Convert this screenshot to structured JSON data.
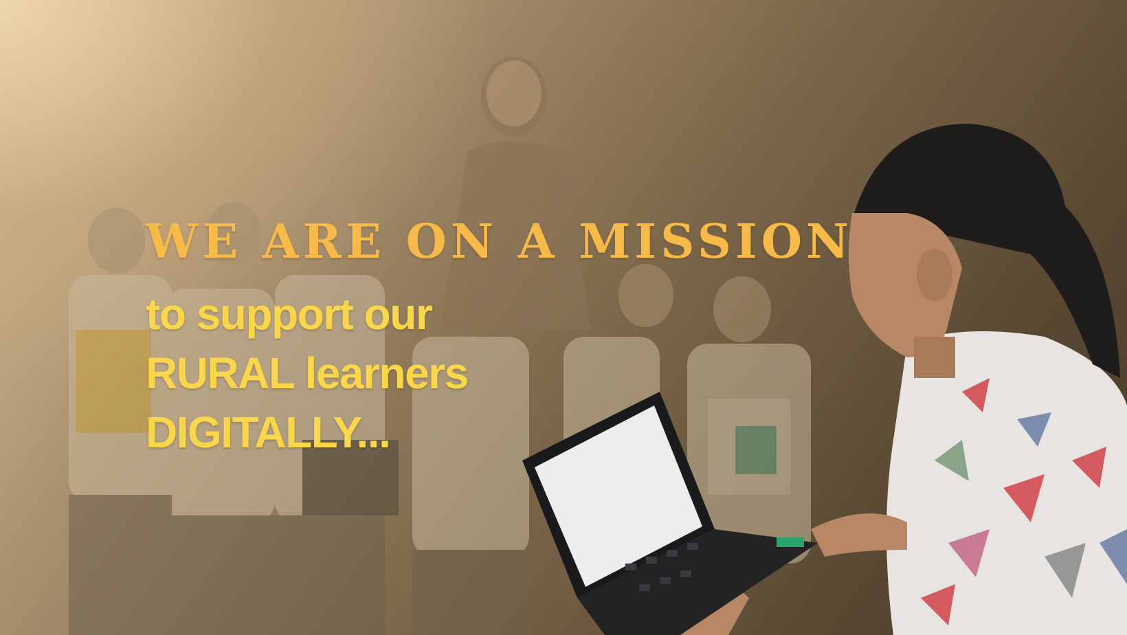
{
  "banner": {
    "headline": "WE ARE ON A MISSION",
    "lines": [
      "to support our",
      "RURAL learners",
      "DIGITALLY..."
    ]
  },
  "colors": {
    "headline": "#f7b948",
    "body_text": "#f9d64a",
    "background_light": "#e9d2ab",
    "background_dark": "#4a3a28"
  }
}
